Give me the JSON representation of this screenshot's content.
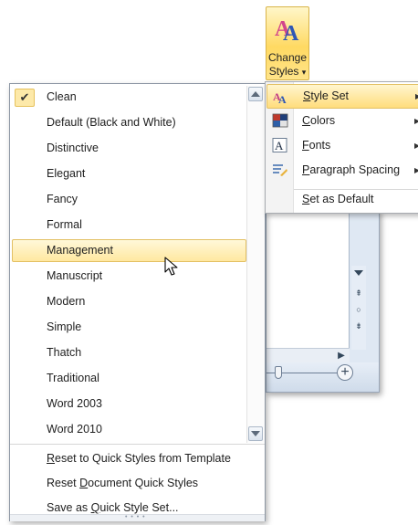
{
  "ribbon": {
    "change_styles_line1": "Change",
    "change_styles_line2": "Styles",
    "change_styles_caret": "▾"
  },
  "gallery": {
    "items": [
      {
        "label": "Clean",
        "checked": true
      },
      {
        "label": "Default (Black and White)"
      },
      {
        "label": "Distinctive"
      },
      {
        "label": "Elegant"
      },
      {
        "label": "Fancy"
      },
      {
        "label": "Formal"
      },
      {
        "label": "Management",
        "hovered": true
      },
      {
        "label": "Manuscript"
      },
      {
        "label": "Modern"
      },
      {
        "label": "Simple"
      },
      {
        "label": "Thatch"
      },
      {
        "label": "Traditional"
      },
      {
        "label": "Word 2003"
      },
      {
        "label": "Word 2010"
      }
    ],
    "check_glyph": "✔",
    "commands": {
      "reset_template_pre": "",
      "reset_template_u": "R",
      "reset_template_post": "eset to Quick Styles from Template",
      "reset_document_pre": "Reset ",
      "reset_document_u": "D",
      "reset_document_post": "ocument Quick Styles",
      "save_pre": "Save as ",
      "save_u": "Q",
      "save_post": "uick Style Set..."
    },
    "grip": "• • • •"
  },
  "submenu": {
    "items": [
      {
        "label_u": "S",
        "label_rest": "tyle Set",
        "icon": "style-set-icon",
        "hovered": true,
        "arrow": "▶"
      },
      {
        "label_u": "C",
        "label_rest": "olors",
        "icon": "colors-icon",
        "arrow": "▶"
      },
      {
        "label_u": "F",
        "label_rest": "onts",
        "icon": "fonts-icon",
        "arrow": "▶"
      },
      {
        "label_u": "P",
        "label_rest": "aragraph Spacing",
        "icon": "paragraph-spacing-icon",
        "arrow": "▶"
      },
      {
        "label_u": "S",
        "label_rest": "et as Default"
      }
    ]
  },
  "doc_window": {
    "scroll_up2": "⇞",
    "scroll_dot": "○",
    "scroll_down2": "⇟",
    "hscroll_right": "▶",
    "zoom_plus": "+"
  },
  "colors": {
    "hover_top": "#fff8d9",
    "hover_bottom": "#ffe8a0",
    "hover_border": "#e3c063"
  }
}
